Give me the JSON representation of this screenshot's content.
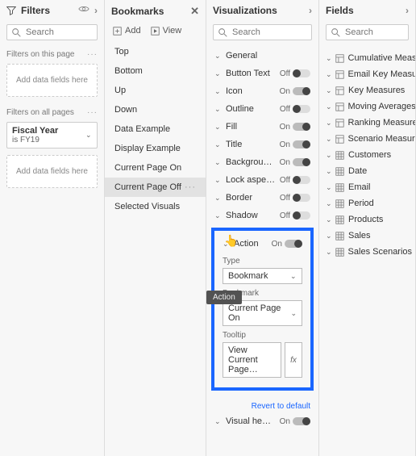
{
  "filters": {
    "title": "Filters",
    "search_placeholder": "Search",
    "sections": {
      "page": {
        "label": "Filters on this page",
        "well": "Add data fields here"
      },
      "all": {
        "label": "Filters on all pages",
        "well": "Add data fields here"
      },
      "chip": {
        "name": "Fiscal Year",
        "desc": "is FY19"
      }
    }
  },
  "bookmarks": {
    "title": "Bookmarks",
    "add": "Add",
    "view": "View",
    "items": [
      "Top",
      "Bottom",
      "Up",
      "Down",
      "Data Example",
      "Display Example",
      "Current Page On",
      "Current Page Off",
      "Selected Visuals"
    ],
    "selected": "Current Page Off"
  },
  "visualizations": {
    "title": "Visualizations",
    "search_placeholder": "Search",
    "rows": [
      {
        "label": "General",
        "toggle": null
      },
      {
        "label": "Button Text",
        "toggle": "off"
      },
      {
        "label": "Icon",
        "toggle": "on"
      },
      {
        "label": "Outline",
        "toggle": "off"
      },
      {
        "label": "Fill",
        "toggle": "on"
      },
      {
        "label": "Title",
        "toggle": "on"
      },
      {
        "label": "Backgrou…",
        "toggle": "on"
      },
      {
        "label": "Lock aspe…",
        "toggle": "off"
      },
      {
        "label": "Border",
        "toggle": "off"
      },
      {
        "label": "Shadow",
        "toggle": "off"
      }
    ],
    "tooltip_pop": "Action",
    "action": {
      "label": "Action",
      "toggle": "on",
      "type_lbl": "Type",
      "type_val": "Bookmark",
      "bookmark_lbl": "Bookmark",
      "bookmark_val": "Current Page On",
      "tooltip_lbl": "Tooltip",
      "tooltip_val": "View Current Page…",
      "revert": "Revert to default"
    },
    "visual_header": {
      "label": "Visual he…",
      "toggle": "on"
    }
  },
  "fields": {
    "title": "Fields",
    "search_placeholder": "Search",
    "items": [
      {
        "icon": "measure",
        "label": "Cumulative Meas…"
      },
      {
        "icon": "measure",
        "label": "Email Key Measur…"
      },
      {
        "icon": "measure",
        "label": "Key Measures"
      },
      {
        "icon": "measure",
        "label": "Moving Averages"
      },
      {
        "icon": "measure",
        "label": "Ranking Measures"
      },
      {
        "icon": "measure",
        "label": "Scenario Measures"
      },
      {
        "icon": "table",
        "label": "Customers"
      },
      {
        "icon": "table",
        "label": "Date"
      },
      {
        "icon": "table",
        "label": "Email"
      },
      {
        "icon": "table",
        "label": "Period"
      },
      {
        "icon": "table",
        "label": "Products"
      },
      {
        "icon": "table",
        "label": "Sales"
      },
      {
        "icon": "table",
        "label": "Sales Scenarios"
      }
    ]
  }
}
